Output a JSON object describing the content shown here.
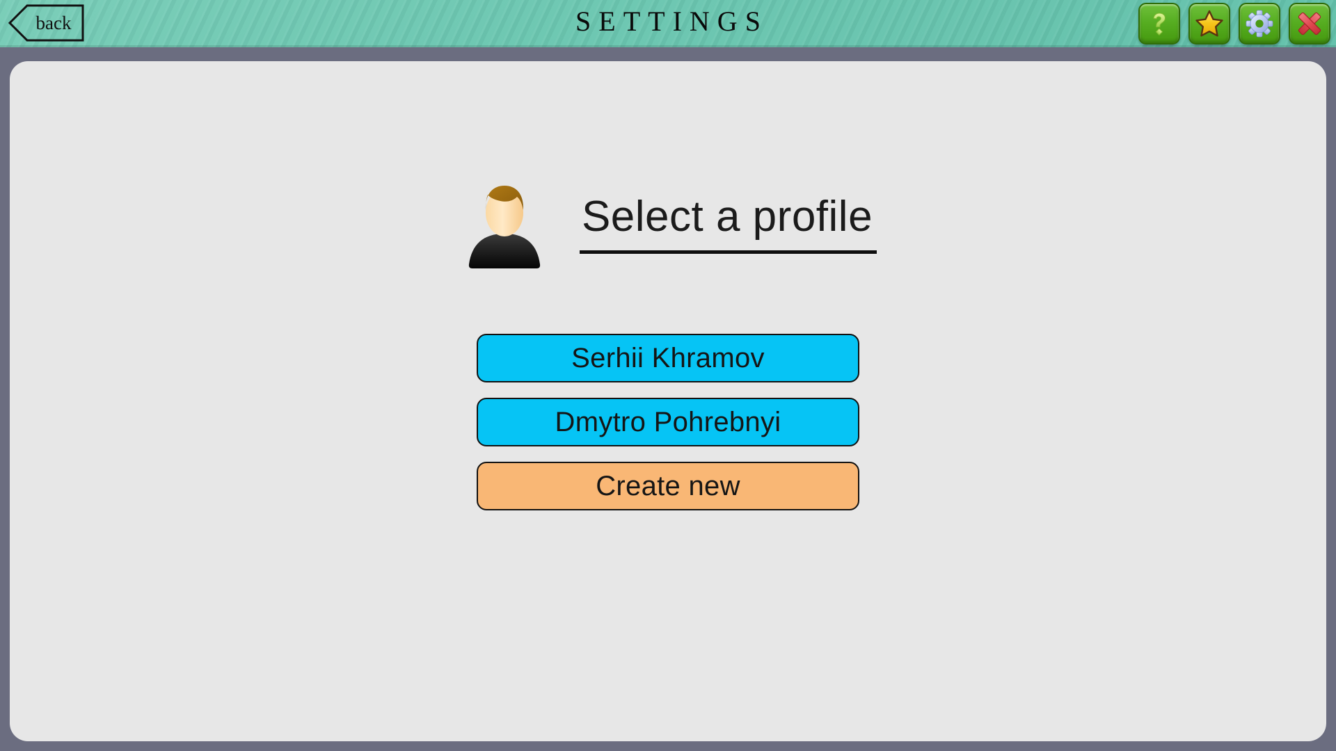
{
  "header": {
    "title": "SETTINGS",
    "back_label": "back",
    "icons": [
      {
        "name": "help-icon",
        "label": "?"
      },
      {
        "name": "star-icon",
        "label": "Favorites"
      },
      {
        "name": "gear-icon",
        "label": "Settings"
      },
      {
        "name": "close-icon",
        "label": "Close"
      }
    ]
  },
  "main": {
    "avatar_icon": "user-avatar-icon",
    "heading": "Select a profile",
    "profiles": [
      {
        "label": "Serhii Khramov",
        "type": "existing"
      },
      {
        "label": "Dmytro Pohrebnyi",
        "type": "existing"
      }
    ],
    "create_label": "Create new"
  },
  "colors": {
    "header_teal": "#6cc7b1",
    "frame_gray": "#6b6d80",
    "panel_gray": "#e7e7e7",
    "profile_cyan": "#06c4f5",
    "create_orange": "#f9b775",
    "icon_green": "#57ae22",
    "star_gold": "#f5c61e",
    "gear_blue": "#b9c8f0",
    "close_red": "#e8555c"
  }
}
